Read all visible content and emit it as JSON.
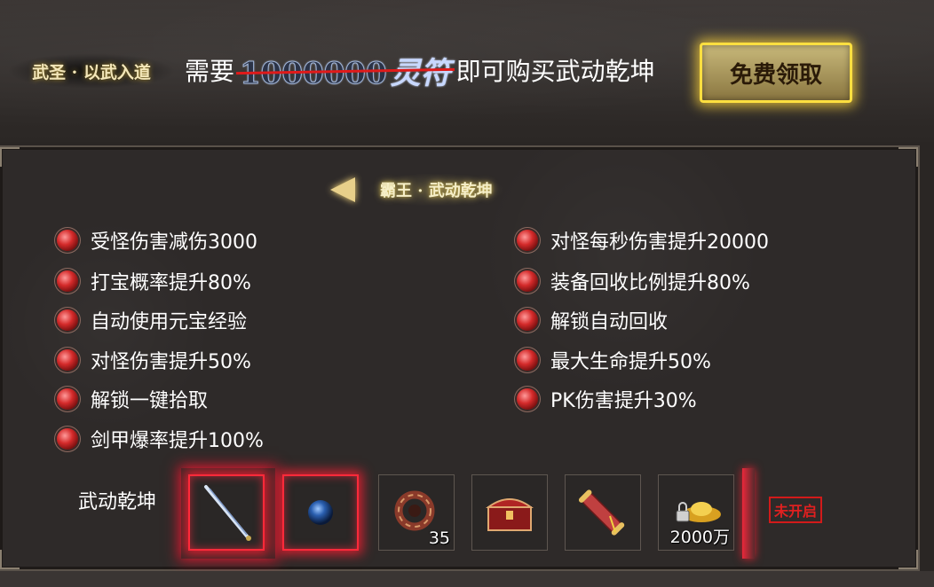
{
  "header": {
    "title": "武圣 · 以武入道",
    "need_text": "需要",
    "original_price": "1000000",
    "currency": "灵符",
    "suffix_text": "即可购买武动乾坤",
    "claim_button": "免费领取"
  },
  "section": {
    "title": "霸王 · 武动乾坤"
  },
  "perks_left": [
    "受怪伤害减伤3000",
    "打宝概率提升80%",
    "自动使用元宝经验",
    "对怪伤害提升50%",
    "解锁一键拾取",
    "剑甲爆率提升100%"
  ],
  "perks_right": [
    "对怪每秒伤害提升20000",
    "装备回收比例提升80%",
    "解锁自动回收",
    "最大生命提升50%",
    "PK伤害提升30%"
  ],
  "rewards": {
    "label": "武动乾坤",
    "items": [
      {
        "icon": "sword-icon",
        "qty": ""
      },
      {
        "icon": "blue-orb-icon",
        "qty": ""
      },
      {
        "icon": "ring-icon",
        "qty": "35"
      },
      {
        "icon": "treasure-chest-icon",
        "qty": ""
      },
      {
        "icon": "scroll-icon",
        "qty": ""
      },
      {
        "icon": "gold-ingot-icon",
        "qty": "2000万"
      }
    ],
    "status": "未开启"
  },
  "colors": {
    "strike": "#e01a1a",
    "highlight_gold": "#ffdf40",
    "slot_glow": "#ff2a3a",
    "bullet": "#d42a2a"
  }
}
